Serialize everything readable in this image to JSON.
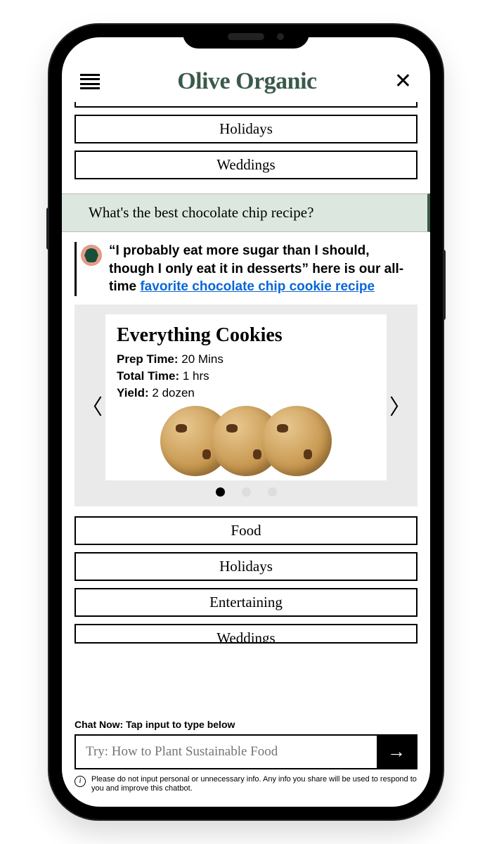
{
  "header": {
    "brand": "Olive Organic"
  },
  "top_categories": [
    "Holidays",
    "Weddings"
  ],
  "prompt": "What's the best chocolate chip recipe?",
  "chat": {
    "text_prefix": "“I probably eat more sugar than I should, though I only eat it in desserts” here is our all-time ",
    "link_text": "favorite chocolate chip cookie recipe"
  },
  "recipe": {
    "title": "Everything Cookies",
    "prep_label": "Prep Time:",
    "prep_value": "20 Mins",
    "total_label": "Total Time:",
    "total_value": "1 hrs",
    "yield_label": "Yield:",
    "yield_value": "2 dozen"
  },
  "bottom_categories": [
    "Food",
    "Holidays",
    "Entertaining",
    "Weddings"
  ],
  "chat_input": {
    "label": "Chat Now: Tap input to type below",
    "placeholder": "Try: How to Plant Sustainable Food"
  },
  "disclaimer": "Please do not input personal or unnecessary info. Any info you share will be used to respond to you and improve this chatbot."
}
